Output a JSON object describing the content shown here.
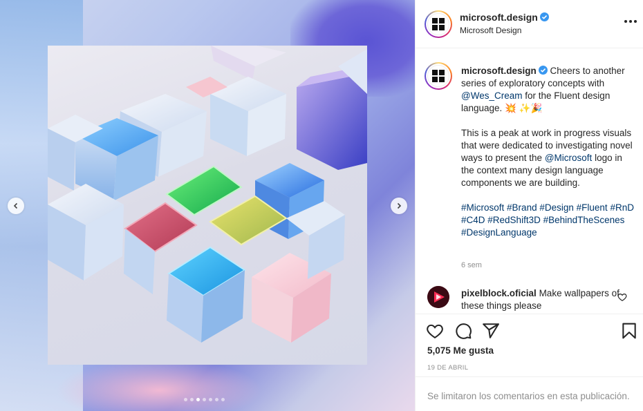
{
  "post": {
    "username": "microsoft.design",
    "subtitle": "Microsoft Design",
    "caption": {
      "intro": "Cheers to another series of exploratory concepts with",
      "mention_1": "@Wes_Cream",
      "after_mention": "for the Fluent design language.",
      "emojis": "💥 ✨🎉",
      "para2_before": "This is a peak at work in progress visuals that were dedicated to investigating novel ways to present the",
      "mention_2": "@Microsoft",
      "para2_after": "logo in the context many design language components we are building.",
      "hashtags": [
        "#Microsoft",
        "#Brand",
        "#Design",
        "#Fluent",
        "#RnD",
        "#C4D",
        "#RedShift3D",
        "#BehindTheScenes",
        "#DesignLanguage"
      ]
    },
    "time_ago": "6 sem",
    "likes": "5,075 Me gusta",
    "date": "19 DE ABRIL",
    "comments_disabled": "Se limitaron los comentarios en esta publicación."
  },
  "comment": {
    "username": "pixelblock.oficial",
    "text": "Make wallpapers of these things please"
  },
  "carousel": {
    "slide_count": 7,
    "active_index": 2
  },
  "colors": {
    "verified": "#3897f0",
    "link": "#00376b",
    "muted": "#8e8e8e",
    "text": "#262626"
  },
  "icons": [
    "more-icon",
    "verified-icon",
    "heart-icon",
    "comment-icon",
    "share-icon",
    "bookmark-icon",
    "prev-arrow-icon",
    "next-arrow-icon"
  ]
}
